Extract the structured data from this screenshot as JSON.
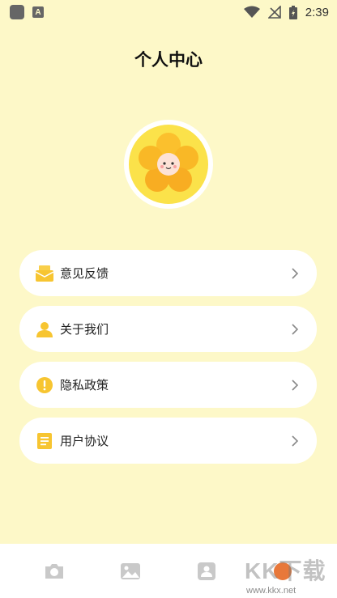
{
  "status_bar": {
    "time": "2:39",
    "icons": [
      "app-square-icon",
      "a-notification-icon",
      "wifi-icon",
      "no-signal-icon",
      "battery-charging-icon"
    ]
  },
  "page": {
    "title": "个人中心"
  },
  "profile": {
    "avatar": "flower-avatar-icon"
  },
  "menu": {
    "items": [
      {
        "label": "意见反馈",
        "icon": "feedback-envelope-icon"
      },
      {
        "label": "关于我们",
        "icon": "person-icon"
      },
      {
        "label": "隐私政策",
        "icon": "exclamation-circle-icon"
      },
      {
        "label": "用户协议",
        "icon": "document-icon"
      }
    ]
  },
  "bottom_nav": {
    "items": [
      {
        "icon": "camera-icon"
      },
      {
        "icon": "image-icon"
      },
      {
        "icon": "user-card-icon"
      }
    ]
  },
  "watermark": {
    "logo_text": "KK下载",
    "url": "www.kkx.net"
  },
  "colors": {
    "background": "#fdf8c8",
    "accent": "#f7c531",
    "card": "#ffffff"
  }
}
